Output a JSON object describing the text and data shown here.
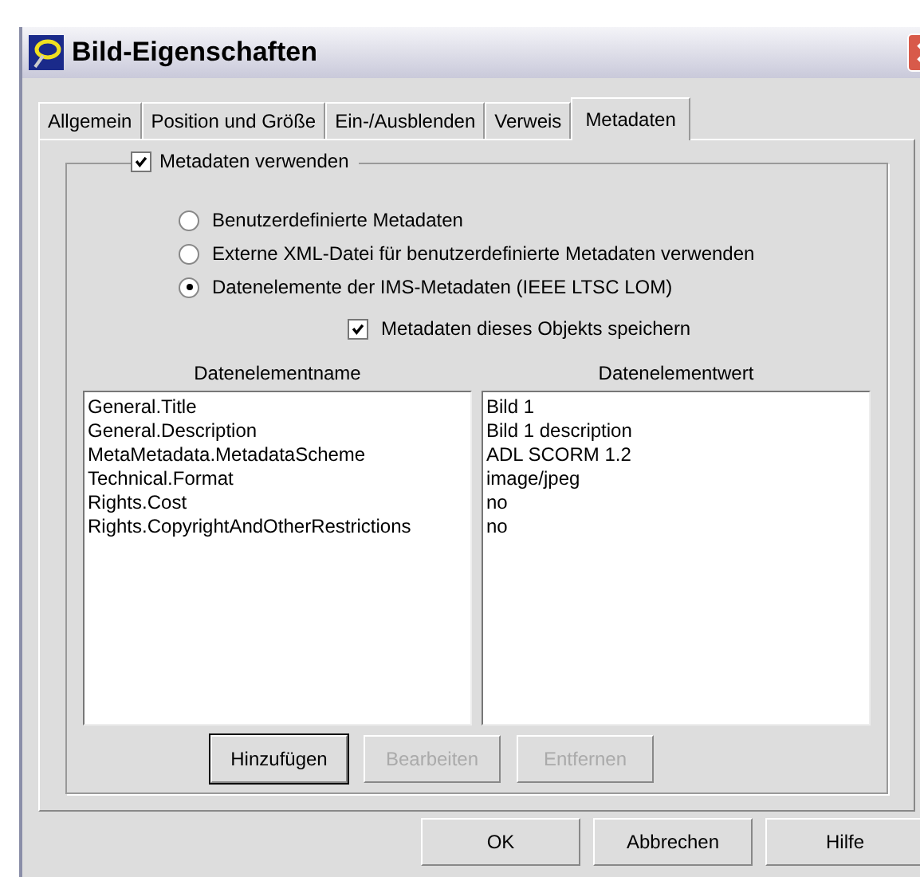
{
  "window": {
    "title": "Bild-Eigenschaften"
  },
  "tabs": [
    {
      "label": "Allgemein",
      "selected": false
    },
    {
      "label": "Position und Größe",
      "selected": false
    },
    {
      "label": "Ein-/Ausblenden",
      "selected": false
    },
    {
      "label": "Verweis",
      "selected": false
    },
    {
      "label": "Metadaten",
      "selected": true
    }
  ],
  "use_metadata": {
    "label": "Metadaten verwenden",
    "checked": true
  },
  "radios": [
    {
      "label": "Benutzerdefinierte Metadaten",
      "selected": false
    },
    {
      "label": "Externe XML-Datei für benutzerdefinierte Metadaten verwenden",
      "selected": false
    },
    {
      "label": "Datenelemente der IMS-Metadaten (IEEE LTSC LOM)",
      "selected": true
    }
  ],
  "save_object": {
    "label": "Metadaten dieses Objekts speichern",
    "checked": true
  },
  "lists": [
    {
      "heading": "Datenelementname",
      "items": [
        "General.Title",
        "General.Description",
        "MetaMetadata.MetadataScheme",
        "Technical.Format",
        "Rights.Cost",
        "Rights.CopyrightAndOtherRestrictions"
      ]
    },
    {
      "heading": "Datenelementwert",
      "items": [
        "Bild 1",
        "Bild 1 description",
        "ADL SCORM 1.2",
        "image/jpeg",
        "no",
        "no"
      ]
    }
  ],
  "list_buttons": [
    {
      "label": "Hinzufügen",
      "disabled": false
    },
    {
      "label": "Bearbeiten",
      "disabled": true
    },
    {
      "label": "Entfernen",
      "disabled": true
    }
  ],
  "dialog_buttons": [
    {
      "label": "OK"
    },
    {
      "label": "Abbrechen"
    },
    {
      "label": "Hilfe"
    }
  ]
}
